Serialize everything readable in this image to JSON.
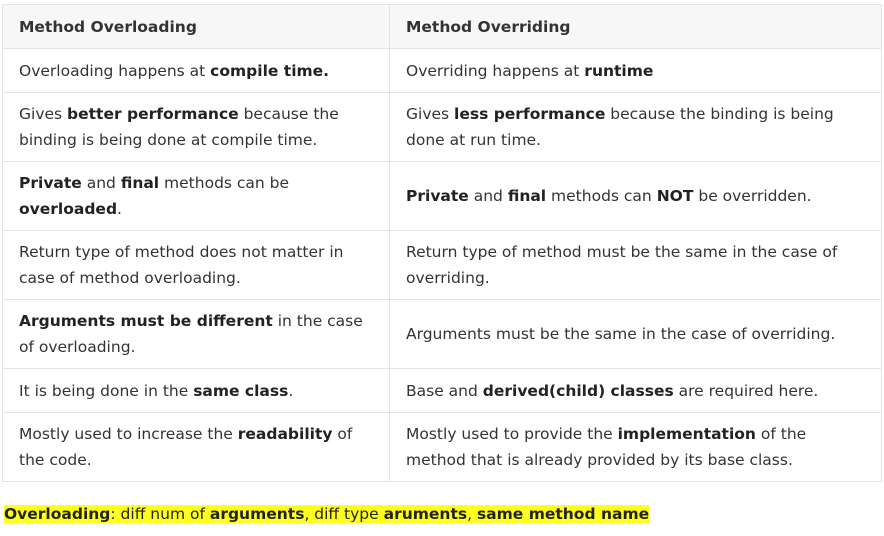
{
  "table": {
    "headers": [
      "Method Overloading",
      "Method Overriding"
    ],
    "rows": [
      {
        "overloading": {
          "t1": "Overloading happens at ",
          "b1": "compile time."
        },
        "overriding": {
          "t1": "Overriding happens at ",
          "b1": "runtime"
        }
      },
      {
        "overloading": {
          "t1": "Gives ",
          "b1": "better performance",
          "t2": " because the binding is being done at compile time."
        },
        "overriding": {
          "t1": "Gives ",
          "b1": "less performance",
          "t2": " because the binding is being done at run time."
        }
      },
      {
        "overloading": {
          "b1": "Private",
          "t1": " and ",
          "b2": "final",
          "t2": " methods can be ",
          "b3": "overloaded",
          "t3": "."
        },
        "overriding": {
          "b1": "Private",
          "t1": " and ",
          "b2": "final",
          "t2": " methods can ",
          "b3": "NOT",
          "t3": " be overridden."
        }
      },
      {
        "overloading": {
          "t1": "Return type of method does not matter in case of method overloading."
        },
        "overriding": {
          "t1": "Return type of method must be the same in the case of overriding."
        }
      },
      {
        "overloading": {
          "b1": "Arguments must be different",
          "t1": " in the case of overloading."
        },
        "overriding": {
          "t1": "Arguments must be the same in the case of overriding."
        }
      },
      {
        "overloading": {
          "t1": "It is being done in the ",
          "b1": "same class",
          "t2": "."
        },
        "overriding": {
          "t1": "Base and ",
          "b1": "derived(child) classes",
          "t2": " are required here."
        }
      },
      {
        "overloading": {
          "t1": "Mostly used to increase the ",
          "b1": "readability",
          "t2": " of the code."
        },
        "overriding": {
          "t1": "Mostly used to provide the ",
          "b1": "implementation",
          "t2": " of the method that is already provided by its base class."
        }
      }
    ]
  },
  "note": {
    "b1": "Overloading",
    "t1": ": diff num of ",
    "b2": "arguments",
    "t2": ", diff type ",
    "b3": "aruments",
    "t3": ", ",
    "b4": "same method name",
    "highlight_color": "#ffff1e"
  }
}
